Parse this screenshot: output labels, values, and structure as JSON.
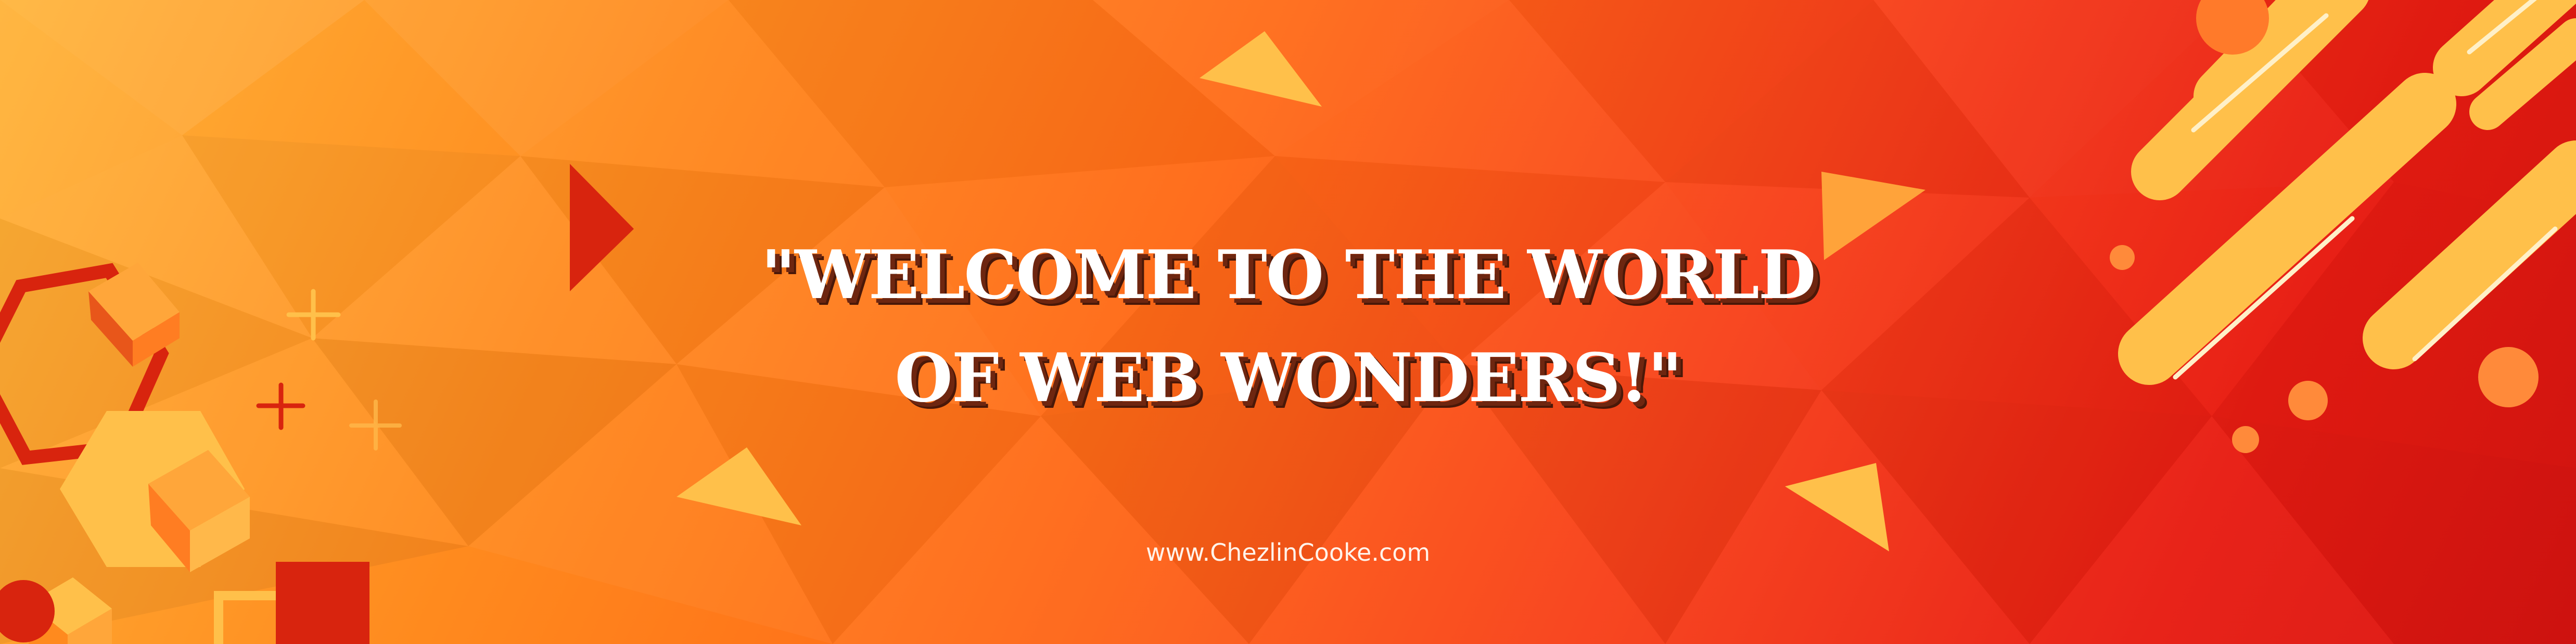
{
  "banner": {
    "headline_line1": "\"WELCOME TO THE WORLD",
    "headline_line2": "OF WEB WONDERS!\"",
    "website": "www.ChezlinCooke.com"
  },
  "colors": {
    "accent_yellow": "#ffc04a",
    "accent_orange": "#ff8a1e",
    "accent_red": "#e81c12",
    "shadow_brown": "#6e2610"
  },
  "icons": [
    "triangle-shape",
    "plus-shape",
    "hexagon-shape",
    "cube-shape",
    "pill-stripe-shape",
    "circle-shape"
  ]
}
